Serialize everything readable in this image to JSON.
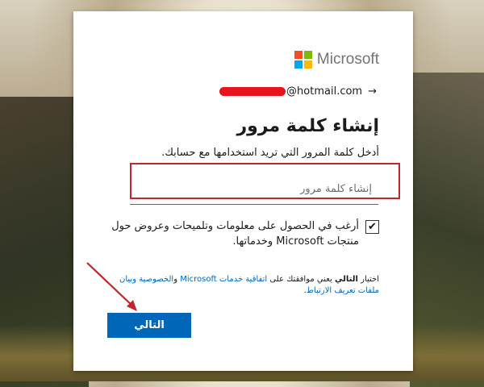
{
  "brand": {
    "name": "Microsoft",
    "colors": [
      "#f25022",
      "#7fba00",
      "#00a4ef",
      "#ffb900"
    ]
  },
  "identity": {
    "email_suffix": "@hotmail.com",
    "arrow_icon": "→"
  },
  "form": {
    "title": "إنشاء كلمة مرور",
    "description": "أدخل كلمة المرور التي تريد استخدامها مع حسابك.",
    "password_placeholder": "إنشاء كلمة مرور",
    "checkbox": {
      "checked": true,
      "label": "أرغب في الحصول على معلومات وتلميحات وعروض حول منتجات Microsoft وخدماتها."
    },
    "terms": {
      "prefix": "اختيار ",
      "bold": "التالي",
      "middle": " يعني موافقتك على ",
      "link1": "اتفاقية خدمات Microsoft",
      "and": " و",
      "link2": "الخصوصية وبيان ملفات تعريف الارتباط",
      "end": "."
    },
    "next_label": "التالي"
  },
  "colors": {
    "accent": "#0067b8",
    "annotation": "#c0262c",
    "redaction": "#e8141c"
  }
}
